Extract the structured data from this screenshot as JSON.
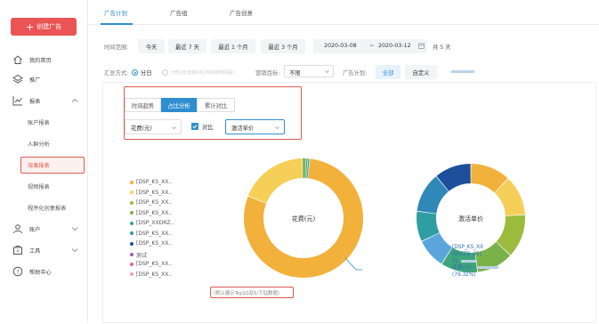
{
  "sidebar": {
    "create_button": "创建广告",
    "items": [
      {
        "label": "我的首页",
        "icon": "home-icon"
      },
      {
        "label": "推广",
        "icon": "layers-icon"
      },
      {
        "label": "报表",
        "icon": "chart-icon"
      },
      {
        "label": "账户报表"
      },
      {
        "label": "人群分析"
      },
      {
        "label": "效果报表"
      },
      {
        "label": "视频报表"
      },
      {
        "label": "程序化创意报表"
      },
      {
        "label": "账户",
        "icon": "user-icon"
      },
      {
        "label": "工具",
        "icon": "toolbox-icon"
      },
      {
        "label": "帮助中心",
        "icon": "help-icon"
      }
    ]
  },
  "tabs": [
    "广告计划",
    "广告组",
    "广告创意"
  ],
  "filters": {
    "time_label": "时间范围:",
    "time_options": [
      "今天",
      "最近 7 天",
      "最近 1 个月",
      "最近 3 个月"
    ],
    "date_start": "2020-03-08",
    "date_sep": "~",
    "date_end": "2020-03-12",
    "days": "共 5 天",
    "agg_label": "汇总方式:",
    "agg_day": "分日",
    "agg_hour": "分时",
    "agg_hour_note": "(仅支持24小时内的时间段)",
    "goal_label": "营销目标:",
    "goal_value": "不限",
    "plan_label": "广告计划:",
    "plan_all": "全部",
    "plan_custom": "自定义"
  },
  "panel": {
    "seg": [
      "时间趋势",
      "占比分析",
      "累计对比"
    ],
    "metric_value": "花费(元)",
    "compare_label": "对比",
    "compare_metric": "激活单价"
  },
  "legend": [
    {
      "label": "[DSP_KS_XX..",
      "color": "#f2b13b"
    },
    {
      "label": "[DSP_KS_XX..",
      "color": "#f5cf57"
    },
    {
      "label": "[DSP_KS_XX..",
      "color": "#9bbb3c"
    },
    {
      "label": "[DSP_KS_XX..",
      "color": "#7ab24a"
    },
    {
      "label": "[DSP_XXDRZ..",
      "color": "#3fa57a"
    },
    {
      "label": "[DSP_KS_XX..",
      "color": "#2f9ea3"
    },
    {
      "label": "[DSP_KS_XX..",
      "color": "#1d4f9c"
    },
    {
      "label": "测试",
      "color": "#a45ac1"
    },
    {
      "label": "[DSP_KS_XX..",
      "color": "#e26a8a"
    },
    {
      "label": "[DSP_KS_XX..",
      "color": "#f0a0a8"
    }
  ],
  "legend_note": "(默认展示Top10及5/下钻数据)",
  "chart_data": [
    {
      "type": "pie",
      "title": "花费(元)",
      "series": [
        {
          "name": "花费(元)",
          "values": [
            79.32,
            18.7,
            1.0,
            0.5,
            0.48
          ]
        }
      ],
      "categories": [
        "[DSP_KS_XXDRZZB_05]",
        "[DSP_KS_XX..",
        "[DSP_KS_XX..",
        "[DSP_KS_XX..",
        "[DSP_KS_XX.."
      ],
      "colors": [
        "#f2b13b",
        "#f5cf57",
        "#7ab24a",
        "#3fa57a",
        "#2f9ea3"
      ]
    },
    {
      "type": "pie",
      "title": "激活单价",
      "series": [
        {
          "name": "激活单价",
          "values": [
            12,
            12,
            13,
            11,
            11,
            9,
            9,
            12,
            11
          ]
        }
      ],
      "colors": [
        "#f2b13b",
        "#f5cf57",
        "#9bbb3c",
        "#7ab24a",
        "#3fa57a",
        "#5aa6dc",
        "#2f9ea3",
        "#2f88b7",
        "#1d4f9c"
      ]
    }
  ],
  "callout": {
    "line1": "[DSP_KS_XX",
    "line2": "DRZZB_05]",
    "line3": "ID",
    "line4": "花费(元):",
    "line5": "(79.32%)"
  }
}
